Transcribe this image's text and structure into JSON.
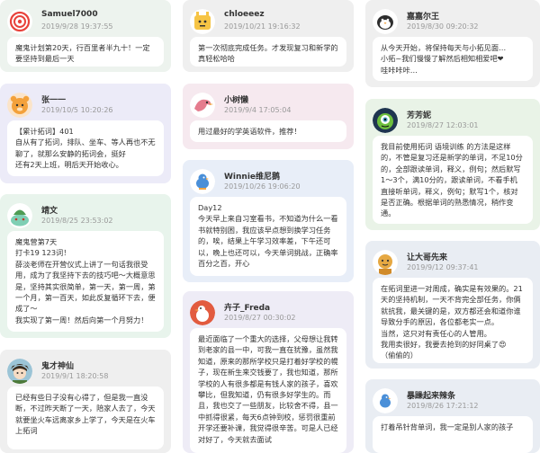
{
  "col1": [
    {
      "name": "Samuel7000",
      "time": "2019/9/28 19:37:55",
      "text": "魔鬼计划第20天，行百里者半九十！一定要坚持到最后一天",
      "avatar": "spiral-avatar",
      "color": "#edf3ee"
    },
    {
      "name": "张一一",
      "time": "2019/10/5 10:20:26",
      "text": "【累计拓词】401\n自从有了拓词，排队、坐车、等人再也不无聊了，就那么安静的拓词会，挺好\n还有2天上班，明后天开始收心。",
      "avatar": "orange-bear-avatar",
      "color": "#ecebf8"
    },
    {
      "name": "靖文",
      "time": "2019/8/25 23:53:02",
      "text": "魔鬼营第7天\n打卡19 123词！\n薛淡老师在开营仪式上讲了一句话我很受用，成为了我坚持下去的技巧吧～大概意思是，坚持其实很简单，第一天，第一周，第一个月，第一百天，如此反复循环下去，便成了～\n我实现了第一周！然后向第一个月努力！",
      "avatar": "bulbasaur-avatar",
      "color": "#e8f4ec"
    },
    {
      "name": "鬼才神仙",
      "time": "2019/9/1 18:20:58",
      "text": "已经有些日子没有心得了，但是我一直没断，不过昨天断了一天，陪家人去了，今天就要坐火车远离家乡上学了，今天是在火车上拓词",
      "avatar": "anime-boy-avatar",
      "color": "#efefef"
    }
  ],
  "col2": [
    {
      "name": "chloeeez",
      "time": "2019/10/21 19:16:32",
      "text": "第一次彻底完成任务。才发现复习和新学的真轻松哈哈",
      "avatar": "yellow-creature-avatar",
      "color": "#efefef"
    },
    {
      "name": "小树懒",
      "time": "2019/9/4 17:05:04",
      "text": "用过最好的学英语软件，推荐！",
      "avatar": "pink-bird-avatar",
      "color": "#f6e9ef"
    },
    {
      "name": "Winnie维尼鹅",
      "time": "2019/10/26 19:06:20",
      "text": "Day12\n今天早上来自习室看书，不知道为什么一看书就特别困，我应该早点想到换学习任务的，唉，结果上午学习效率差，下午还可以，晚上也还可以，今天单词挑战，正确率百分之百，开心",
      "avatar": "blue-bird-avatar",
      "color": "#e8eef8"
    },
    {
      "name": "卉子_Freda",
      "time": "2019/8/27 00:30:02",
      "text": "最近面临了一个重大的选择，父母想让我转到老家的县一中，可我一直在犹豫，虽然我知道，原来的那所学校只是打着好学校的幌子，现在新生来交钱要了，我也知道，那所学校的人有很多都是有钱人家的孩子，喜欢攀比，但我知道，仍有很多好学生的。而且，我也交了一些朋友，比较舍不得，县一中抓得很紧，每天6点钟到校，惩罚很重前开学还要补课，我觉得很辛苦。可是人已经对好了，今天就去面试",
      "avatar": "goose-avatar",
      "color": "#eeecf6"
    }
  ],
  "col3": [
    {
      "name": "嘉嘉尔王",
      "time": "2019/8/30 09:20:32",
      "text": "从今天开始，将保持每天与小拓见面…\n小拓~我们慢慢了解然后相知相爱吧❤\n哇咔咔咔…",
      "avatar": "penguin-avatar",
      "color": "#efefef"
    },
    {
      "name": "芳芳妮",
      "time": "2019/8/27 12:03:01",
      "text": "我目前使用拓词 语境训练 的方法是这样的，不管是复习还是新学的单词，不足10分的，全部跟读单词，释义，例句；然后默写1～3个，满10分的，跟读单词，不看手机直接听单词，释义，例句；默写1个，核对是否正确。根据单词的熟悉情况，稍作变通。",
      "avatar": "mike-monster-avatar",
      "color": "#e9f3e7"
    },
    {
      "name": "让大哥先来",
      "time": "2019/9/12 09:37:41",
      "text": "在拓词里进一对周成，确实是有效果的。21天的坚持机制，一天不背完全部任务，你俩就抗我，最关键的是，双方都还会和道你谁导致分手的原因，各位都老实一点。\n当然，这只对有责任心的人管用。\n我用卖很好，我要去抢到的好同桌了😍\n（偷偷的）",
      "avatar": "monk-avatar",
      "color": "#e9edf3"
    },
    {
      "name": "暴躁起来辣条",
      "time": "2019/8/26 17:21:12",
      "text": "打着吊针背单词，我一定是别人家的孩子",
      "avatar": "bluebird-small-avatar",
      "color": "#e9edf3"
    }
  ]
}
